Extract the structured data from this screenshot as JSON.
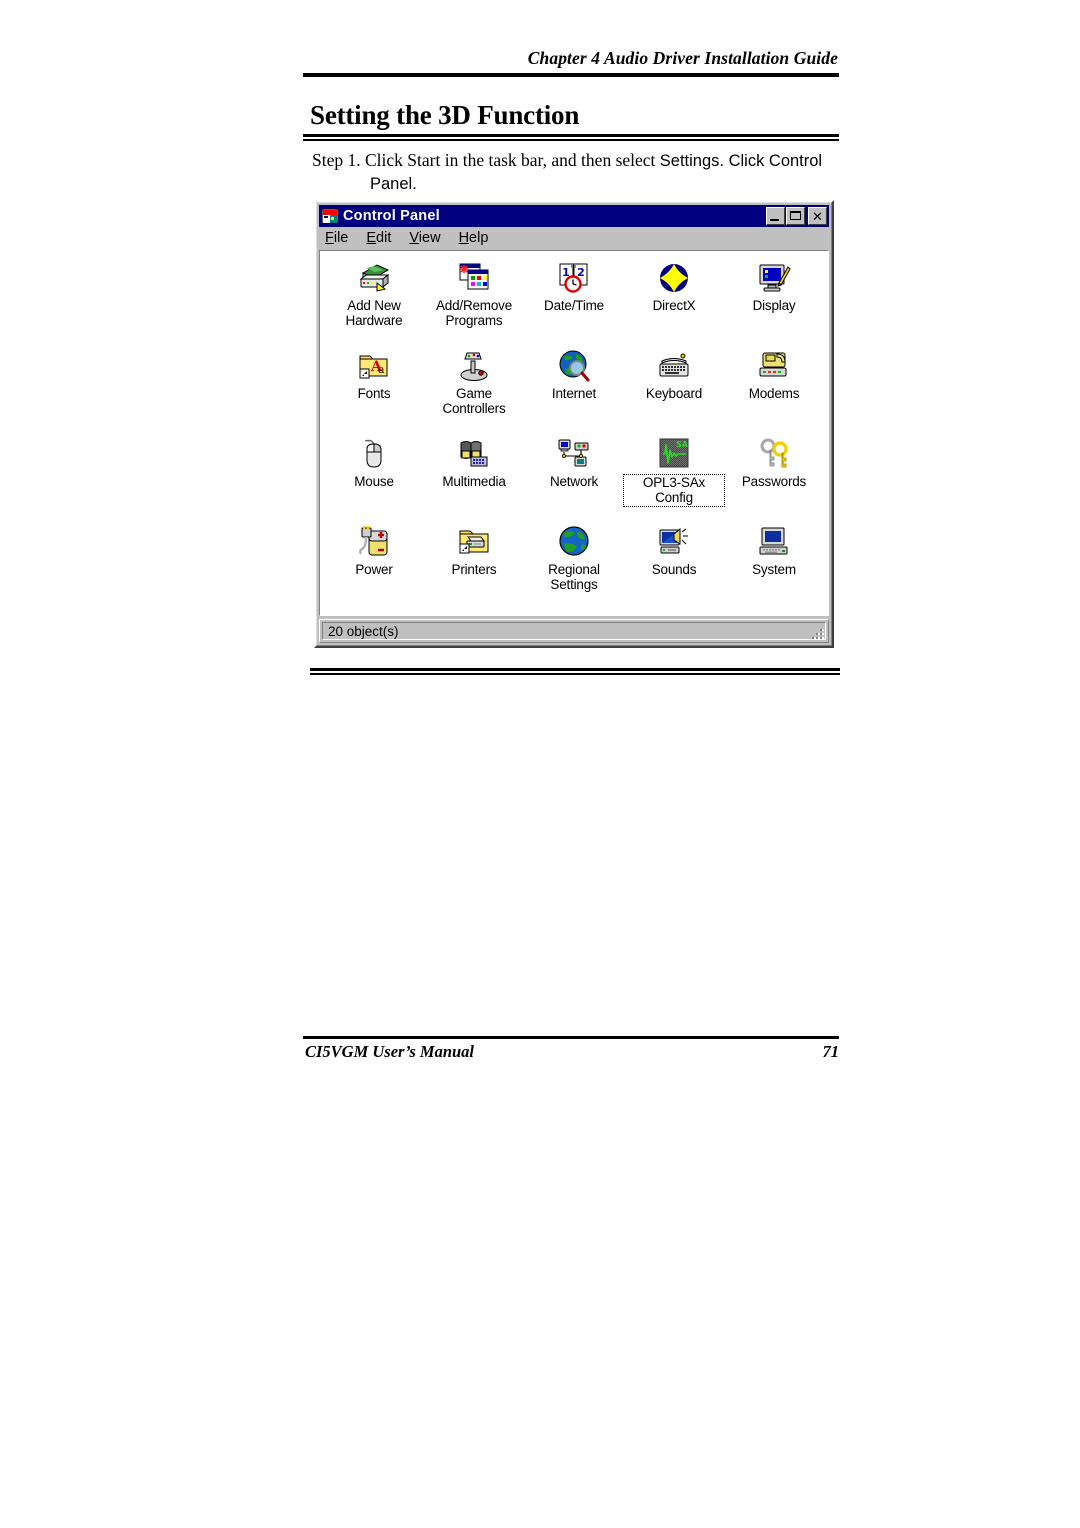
{
  "document": {
    "running_header": "Chapter 4  Audio Driver Installation Guide",
    "section_title": "Setting the 3D Function",
    "step": {
      "label": "Step 1.",
      "line1_serif": "Click Start in the task bar, and then select ",
      "line1_sans": "Settings. Click Control",
      "line2_sans": "Panel."
    },
    "footer": {
      "manual": "CI5VGM User’s Manual",
      "page": "71"
    }
  },
  "control_panel": {
    "title": "Control Panel",
    "title_icon": "control-panel-icon",
    "window_buttons": [
      {
        "name": "minimize",
        "glyph": "_"
      },
      {
        "name": "maximize",
        "glyph": "□"
      },
      {
        "name": "close",
        "glyph": "×"
      }
    ],
    "menus": [
      {
        "accel": "F",
        "rest": "ile"
      },
      {
        "accel": "E",
        "rest": "dit"
      },
      {
        "accel": "V",
        "rest": "iew"
      },
      {
        "accel": "H",
        "rest": "elp"
      }
    ],
    "items": [
      {
        "label": "Add New Hardware",
        "icon": "add-new-hardware-icon",
        "selected": false
      },
      {
        "label": "Add/Remove Programs",
        "icon": "add-remove-programs-icon",
        "selected": false
      },
      {
        "label": "Date/Time",
        "icon": "date-time-icon",
        "selected": false
      },
      {
        "label": "DirectX",
        "icon": "directx-icon",
        "selected": false
      },
      {
        "label": "Display",
        "icon": "display-icon",
        "selected": false
      },
      {
        "label": "Fonts",
        "icon": "fonts-icon",
        "selected": false
      },
      {
        "label": "Game Controllers",
        "icon": "game-controllers-icon",
        "selected": false
      },
      {
        "label": "Internet",
        "icon": "internet-icon",
        "selected": false
      },
      {
        "label": "Keyboard",
        "icon": "keyboard-icon",
        "selected": false
      },
      {
        "label": "Modems",
        "icon": "modems-icon",
        "selected": false
      },
      {
        "label": "Mouse",
        "icon": "mouse-icon",
        "selected": false
      },
      {
        "label": "Multimedia",
        "icon": "multimedia-icon",
        "selected": false
      },
      {
        "label": "Network",
        "icon": "network-icon",
        "selected": false
      },
      {
        "label": "OPL3-SAx Config",
        "icon": "opl3-sax-config-icon",
        "selected": true
      },
      {
        "label": "Passwords",
        "icon": "passwords-icon",
        "selected": false
      },
      {
        "label": "Power",
        "icon": "power-icon",
        "selected": false
      },
      {
        "label": "Printers",
        "icon": "printers-icon",
        "selected": false
      },
      {
        "label": "Regional Settings",
        "icon": "regional-settings-icon",
        "selected": false
      },
      {
        "label": "Sounds",
        "icon": "sounds-icon",
        "selected": false
      },
      {
        "label": "System",
        "icon": "system-icon",
        "selected": false
      }
    ],
    "status": "20 object(s)",
    "colors": {
      "titlebar": "#000080",
      "face": "#c0c0c0",
      "client": "#ffffff",
      "text": "#000000",
      "accent_yellow": "#ffff00",
      "accent_green": "#00d000"
    }
  }
}
